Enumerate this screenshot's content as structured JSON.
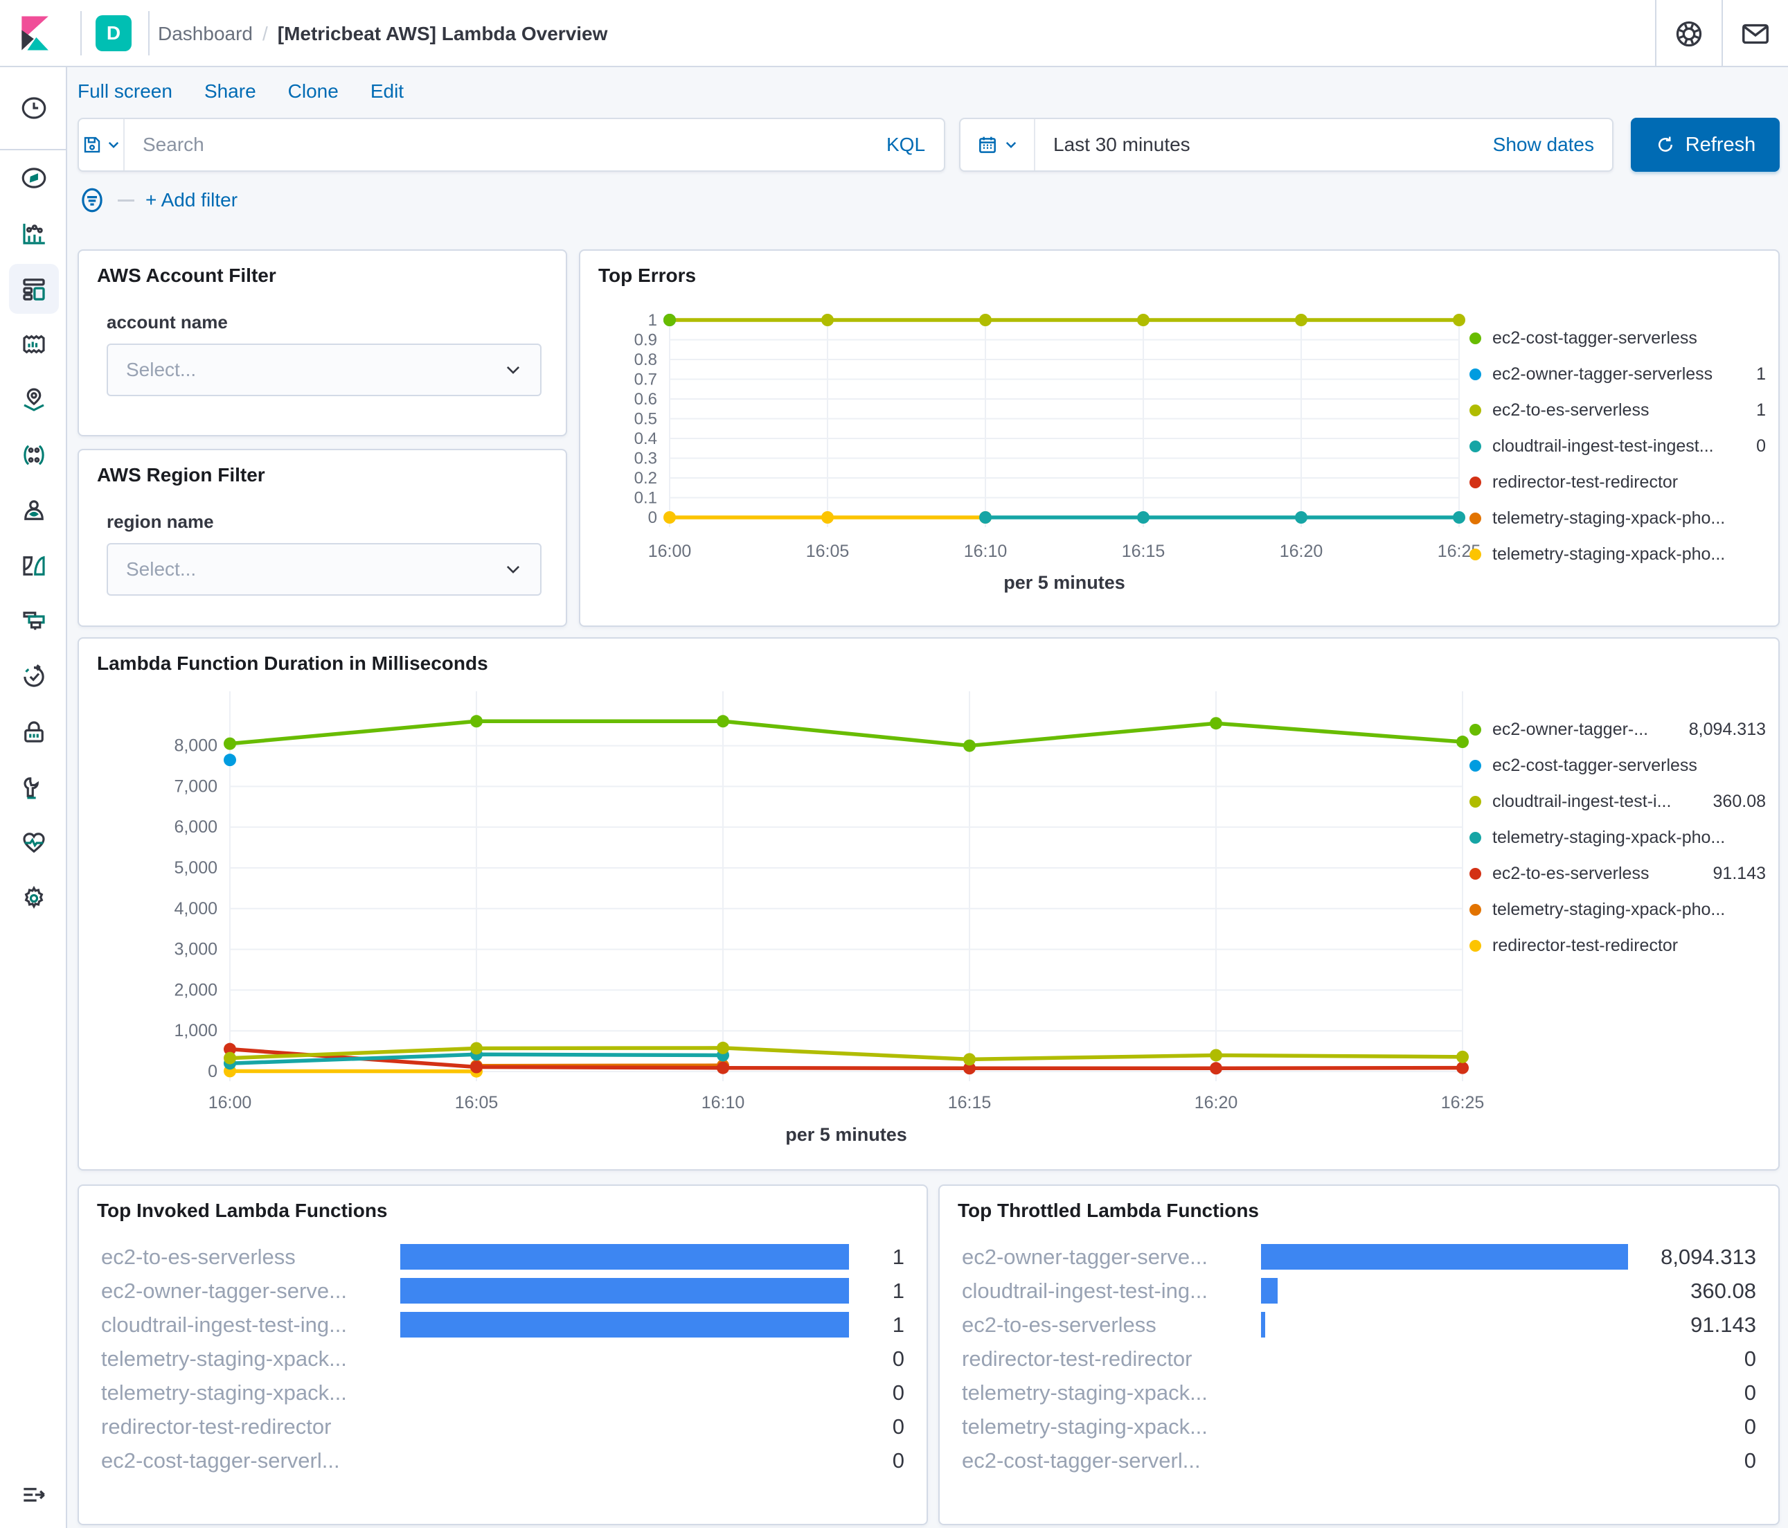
{
  "header": {
    "app_badge": "D",
    "breadcrumb": {
      "section": "Dashboard",
      "separator": "/",
      "page": "[Metricbeat AWS] Lambda Overview"
    },
    "icons": [
      "help-buoy",
      "mail"
    ]
  },
  "sidebar": {
    "icons": [
      "recent",
      "discover",
      "visualize",
      "dashboard",
      "canvas",
      "maps",
      "machine-learning",
      "graph",
      "reporting",
      "dev-tools",
      "uptime",
      "security",
      "stack-management",
      "monitoring",
      "settings",
      "collapse-menu"
    ],
    "selected": "dashboard"
  },
  "toolbar": {
    "menu": [
      "Full screen",
      "Share",
      "Clone",
      "Edit"
    ],
    "search_placeholder": "Search",
    "kql_label": "KQL",
    "time_range": "Last 30 minutes",
    "show_dates_label": "Show dates",
    "refresh_label": "Refresh",
    "add_filter_label": "+ Add filter"
  },
  "panels": {
    "account_filter": {
      "title": "AWS Account Filter",
      "field_label": "account name",
      "select_placeholder": "Select..."
    },
    "region_filter": {
      "title": "AWS Region Filter",
      "field_label": "region name",
      "select_placeholder": "Select..."
    },
    "top_errors": {
      "title": "Top Errors"
    },
    "duration": {
      "title": "Lambda Function Duration in Milliseconds"
    },
    "top_invoked": {
      "title": "Top Invoked Lambda Functions"
    },
    "top_throttled": {
      "title": "Top Throttled Lambda Functions"
    }
  },
  "colors": {
    "accent_link": "#006BB4",
    "refresh_button": "#006BB4",
    "badge_teal": "#00BFB3",
    "bar_blue": "#3D86F2",
    "series_green": "#68BC00",
    "series_blue": "#009CE0",
    "series_olive": "#B0BC00",
    "series_teal": "#16A5A5",
    "series_red": "#D33115",
    "series_orange": "#E27300",
    "series_yellow": "#FCC400"
  },
  "chart_data": [
    {
      "id": "top-errors",
      "type": "line",
      "title": "Top Errors",
      "xlabel": "per 5 minutes",
      "categories": [
        "16:00",
        "16:05",
        "16:10",
        "16:15",
        "16:20",
        "16:25"
      ],
      "ylim": [
        0,
        1
      ],
      "grid": true,
      "legend_position": "right",
      "yticks": [
        {
          "v": 0,
          "label": "0"
        },
        {
          "v": 0.1,
          "label": "0.1"
        },
        {
          "v": 0.2,
          "label": "0.2"
        },
        {
          "v": 0.3,
          "label": "0.3"
        },
        {
          "v": 0.4,
          "label": "0.4"
        },
        {
          "v": 0.5,
          "label": "0.5"
        },
        {
          "v": 0.6,
          "label": "0.6"
        },
        {
          "v": 0.7,
          "label": "0.7"
        },
        {
          "v": 0.8,
          "label": "0.8"
        },
        {
          "v": 0.9,
          "label": "0.9"
        },
        {
          "v": 1,
          "label": "1"
        }
      ],
      "series": [
        {
          "name": "ec2-cost-tagger-serverless",
          "color": "#68BC00",
          "legend_value": "",
          "points": [
            [
              0,
              1
            ]
          ]
        },
        {
          "name": "ec2-owner-tagger-serverless",
          "color": "#009CE0",
          "legend_value": "1",
          "points": [
            [
              0,
              1
            ]
          ]
        },
        {
          "name": "ec2-to-es-serverless",
          "color": "#B0BC00",
          "legend_value": "1",
          "points": [
            [
              0,
              1
            ],
            [
              1,
              1
            ],
            [
              2,
              1
            ],
            [
              3,
              1
            ],
            [
              4,
              1
            ],
            [
              5,
              1
            ]
          ]
        },
        {
          "name": "cloudtrail-ingest-test-ingest...",
          "color": "#16A5A5",
          "legend_value": "0",
          "points": [
            [
              2,
              0
            ],
            [
              3,
              0
            ],
            [
              4,
              0
            ],
            [
              5,
              0
            ]
          ]
        },
        {
          "name": "redirector-test-redirector",
          "color": "#D33115",
          "legend_value": "",
          "points": []
        },
        {
          "name": "telemetry-staging-xpack-pho...",
          "color": "#E27300",
          "legend_value": "",
          "points": []
        },
        {
          "name": "telemetry-staging-xpack-pho...",
          "color": "#FCC400",
          "legend_value": "",
          "points": [
            [
              0,
              0
            ],
            [
              1,
              0
            ],
            [
              2,
              0
            ]
          ]
        }
      ]
    },
    {
      "id": "duration",
      "type": "line",
      "title": "Lambda Function Duration in Milliseconds",
      "xlabel": "per 5 minutes",
      "categories": [
        "16:00",
        "16:05",
        "16:10",
        "16:15",
        "16:20",
        "16:25"
      ],
      "ylim": [
        0,
        9200
      ],
      "grid": true,
      "legend_position": "right",
      "yticks": [
        {
          "v": 0,
          "label": "0"
        },
        {
          "v": 1000,
          "label": "1,000"
        },
        {
          "v": 2000,
          "label": "2,000"
        },
        {
          "v": 3000,
          "label": "3,000"
        },
        {
          "v": 4000,
          "label": "4,000"
        },
        {
          "v": 5000,
          "label": "5,000"
        },
        {
          "v": 6000,
          "label": "6,000"
        },
        {
          "v": 7000,
          "label": "7,000"
        },
        {
          "v": 8000,
          "label": "8,000"
        }
      ],
      "series": [
        {
          "name": "ec2-owner-tagger-...",
          "color": "#68BC00",
          "legend_value": "8,094.313",
          "points": [
            [
              0,
              8050
            ],
            [
              1,
              8600
            ],
            [
              2,
              8600
            ],
            [
              3,
              8000
            ],
            [
              4,
              8550
            ],
            [
              5,
              8094.313
            ]
          ]
        },
        {
          "name": "ec2-cost-tagger-serverless",
          "color": "#009CE0",
          "legend_value": "",
          "points": [
            [
              0,
              7650
            ]
          ]
        },
        {
          "name": "cloudtrail-ingest-test-i...",
          "color": "#B0BC00",
          "legend_value": "360.08",
          "points": [
            [
              0,
              330
            ],
            [
              1,
              570
            ],
            [
              2,
              580
            ],
            [
              3,
              300
            ],
            [
              4,
              400
            ],
            [
              5,
              360.08
            ]
          ]
        },
        {
          "name": "telemetry-staging-xpack-pho...",
          "color": "#16A5A5",
          "legend_value": "",
          "points": [
            [
              0,
              200
            ],
            [
              1,
              420
            ],
            [
              2,
              400
            ]
          ]
        },
        {
          "name": "ec2-to-es-serverless",
          "color": "#D33115",
          "legend_value": "91.143",
          "points": [
            [
              0,
              550
            ],
            [
              1,
              110
            ],
            [
              2,
              90
            ],
            [
              3,
              80
            ],
            [
              4,
              80
            ],
            [
              5,
              91.143
            ]
          ]
        },
        {
          "name": "telemetry-staging-xpack-pho...",
          "color": "#E27300",
          "legend_value": "",
          "points": [
            [
              1,
              140
            ],
            [
              2,
              150
            ]
          ]
        },
        {
          "name": "redirector-test-redirector",
          "color": "#FCC400",
          "legend_value": "",
          "points": [
            [
              0,
              10
            ],
            [
              1,
              5
            ]
          ]
        }
      ]
    },
    {
      "id": "top-invoked",
      "type": "bar",
      "title": "Top Invoked Lambda Functions",
      "orientation": "horizontal",
      "max": 1,
      "rows": [
        {
          "label": "ec2-to-es-serverless",
          "value": 1,
          "display": "1"
        },
        {
          "label": "ec2-owner-tagger-serve...",
          "value": 1,
          "display": "1"
        },
        {
          "label": "cloudtrail-ingest-test-ing...",
          "value": 1,
          "display": "1"
        },
        {
          "label": "telemetry-staging-xpack...",
          "value": 0,
          "display": "0"
        },
        {
          "label": "telemetry-staging-xpack...",
          "value": 0,
          "display": "0"
        },
        {
          "label": "redirector-test-redirector",
          "value": 0,
          "display": "0"
        },
        {
          "label": "ec2-cost-tagger-serverl...",
          "value": 0,
          "display": "0"
        }
      ]
    },
    {
      "id": "top-throttled",
      "type": "bar",
      "title": "Top Throttled Lambda Functions",
      "orientation": "horizontal",
      "max": 8094.313,
      "rows": [
        {
          "label": "ec2-owner-tagger-serve...",
          "value": 8094.313,
          "display": "8,094.313"
        },
        {
          "label": "cloudtrail-ingest-test-ing...",
          "value": 360.08,
          "display": "360.08"
        },
        {
          "label": "ec2-to-es-serverless",
          "value": 91.143,
          "display": "91.143"
        },
        {
          "label": "redirector-test-redirector",
          "value": 0,
          "display": "0"
        },
        {
          "label": "telemetry-staging-xpack...",
          "value": 0,
          "display": "0"
        },
        {
          "label": "telemetry-staging-xpack...",
          "value": 0,
          "display": "0"
        },
        {
          "label": "ec2-cost-tagger-serverl...",
          "value": 0,
          "display": "0"
        }
      ]
    }
  ]
}
